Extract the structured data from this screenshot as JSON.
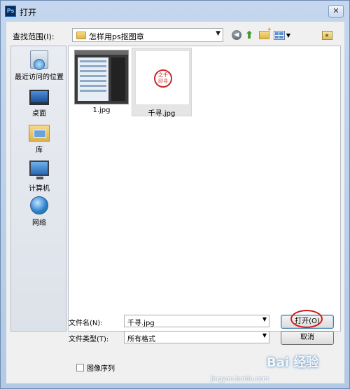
{
  "window": {
    "title": "打开",
    "app_icon": "Ps"
  },
  "header": {
    "look_in_label": "查找范围(I):",
    "look_in_value": "怎样用ps抠图章"
  },
  "places": [
    {
      "label": "最近访问的位置",
      "icon": "recent-places-icon"
    },
    {
      "label": "桌面",
      "icon": "desktop-icon"
    },
    {
      "label": "库",
      "icon": "library-icon"
    },
    {
      "label": "计算机",
      "icon": "computer-icon"
    },
    {
      "label": "网络",
      "icon": "network-icon"
    }
  ],
  "files": [
    {
      "name": "1.jpg",
      "selected": false
    },
    {
      "name": "千寻.jpg",
      "selected": true,
      "seal_text": "之千印寻"
    }
  ],
  "form": {
    "filename_label": "文件名(N):",
    "filename_value": "千寻.jpg",
    "filetype_label": "文件类型(T):",
    "filetype_value": "所有格式",
    "open_button": "打开(O)",
    "cancel_button": "取消",
    "image_sequence_label": "图像序列",
    "image_sequence_checked": false
  },
  "watermark": {
    "text": "Bai 经验",
    "sub": "jingyan.baidu.com"
  },
  "colors": {
    "highlight": "#d41a1a",
    "seal": "#c8282a"
  }
}
